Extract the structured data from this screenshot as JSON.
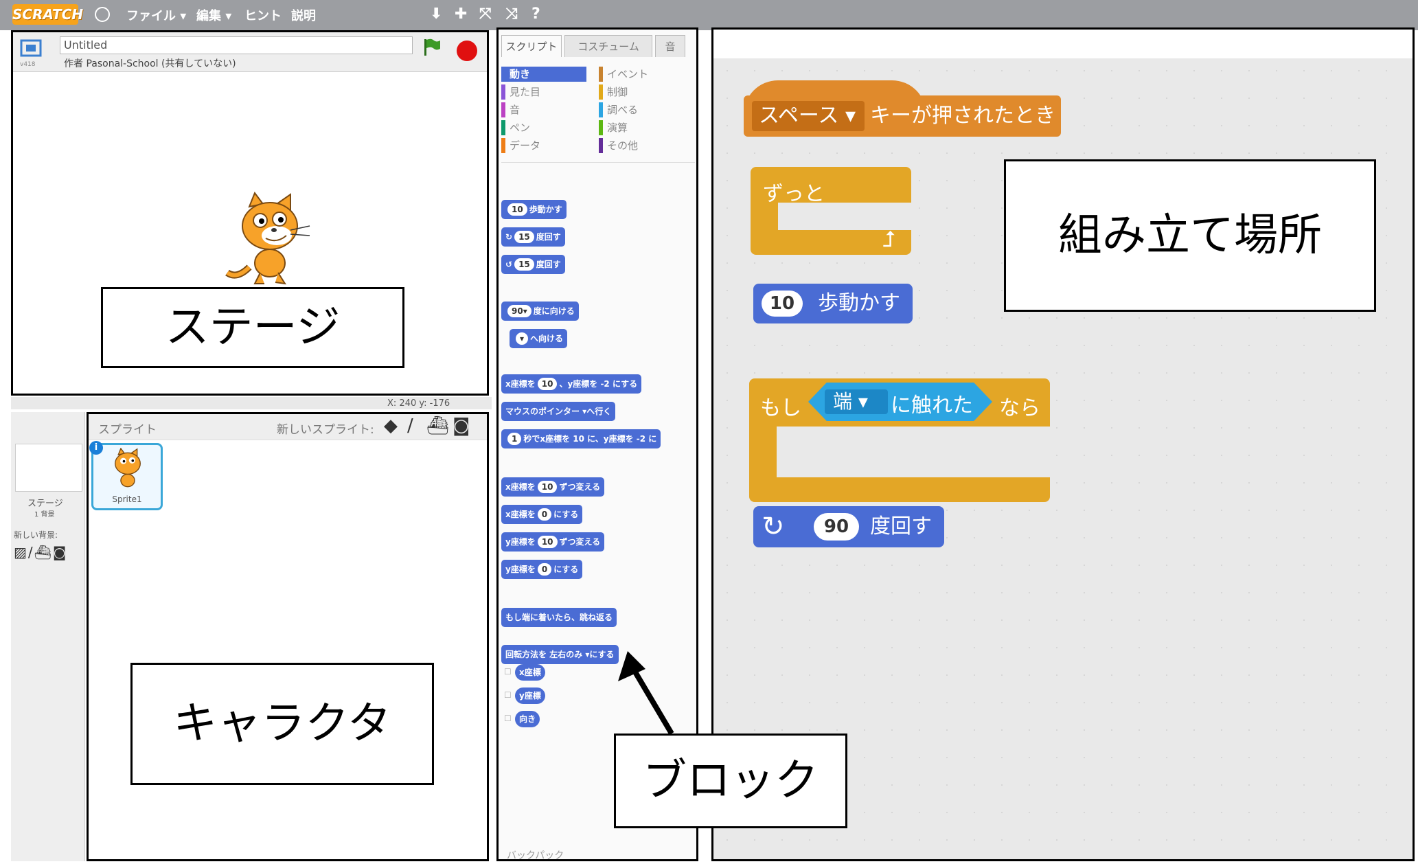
{
  "menu": {
    "logo": "SCRATCH",
    "items": [
      "ファイル ▾",
      "編集 ▾",
      "ヒント",
      "説明"
    ]
  },
  "stage": {
    "title": "Untitled",
    "author": "作者 Pasonal-School (共有していない)",
    "version": "v418",
    "coords": "X: 240  y: -176"
  },
  "sprites": {
    "header": "スプライト",
    "new_sprite": "新しいスプライト:",
    "stage_label": "ステージ",
    "stage_sub": "1 背景",
    "new_backdrop": "新しい背景:",
    "sprite1": "Sprite1"
  },
  "palette": {
    "tabs": [
      "スクリプト",
      "コスチューム",
      "音"
    ],
    "categories_left": [
      "動き",
      "見た目",
      "音",
      "ペン",
      "データ"
    ],
    "categories_right": [
      "イベント",
      "制御",
      "調べる",
      "演算",
      "その他"
    ],
    "cat_colors_left": [
      "#4a6cd4",
      "#8a55d7",
      "#bb42c3",
      "#0e9a6c",
      "#ee7d16"
    ],
    "cat_colors_right": [
      "#c88330",
      "#e1a91a",
      "#2ca5e2",
      "#5cb712",
      "#632d99"
    ],
    "blocks": [
      {
        "pre": "",
        "num": "10",
        "post": "歩動かす"
      },
      {
        "pre": "↻",
        "num": "15",
        "post": "度回す"
      },
      {
        "pre": "↺",
        "num": "15",
        "post": "度回す"
      },
      {
        "pre": "",
        "num": "90▾",
        "post": "度に向ける"
      },
      {
        "pre": "",
        "num": "▾",
        "post": "へ向ける"
      },
      {
        "pre": "x座標を",
        "num": "10",
        "post": "、y座標を -2 にする"
      },
      {
        "pre": "マウスのポインター ▾",
        "num": "",
        "post": "へ行く"
      },
      {
        "pre": "",
        "num": "1",
        "post": "秒でx座標を 10 に、y座標を -2 に"
      },
      {
        "pre": "x座標を",
        "num": "10",
        "post": "ずつ変える"
      },
      {
        "pre": "x座標を",
        "num": "0",
        "post": "にする"
      },
      {
        "pre": "y座標を",
        "num": "10",
        "post": "ずつ変える"
      },
      {
        "pre": "y座標を",
        "num": "0",
        "post": "にする"
      },
      {
        "pre": "もし端に着いたら、跳ね返る",
        "num": "",
        "post": ""
      },
      {
        "pre": "回転方法を 左右のみ ▾",
        "num": "",
        "post": "にする"
      }
    ],
    "reporters": [
      "x座標",
      "y座標",
      "向き"
    ],
    "footer": "バックパック"
  },
  "script": {
    "hat_key": "スペース",
    "hat_text": "キーが押されたとき",
    "forever": "ずっと",
    "move_num": "10",
    "move_text": "歩動かす",
    "if_label": "もし",
    "touch_target": "端",
    "touch_text": "に触れた",
    "then_label": "なら",
    "turn_num": "90",
    "turn_text": "度回す"
  },
  "callouts": {
    "stage": "ステージ",
    "character": "キャラクタ",
    "block": "ブロック",
    "assembly": "組み立て場所"
  }
}
